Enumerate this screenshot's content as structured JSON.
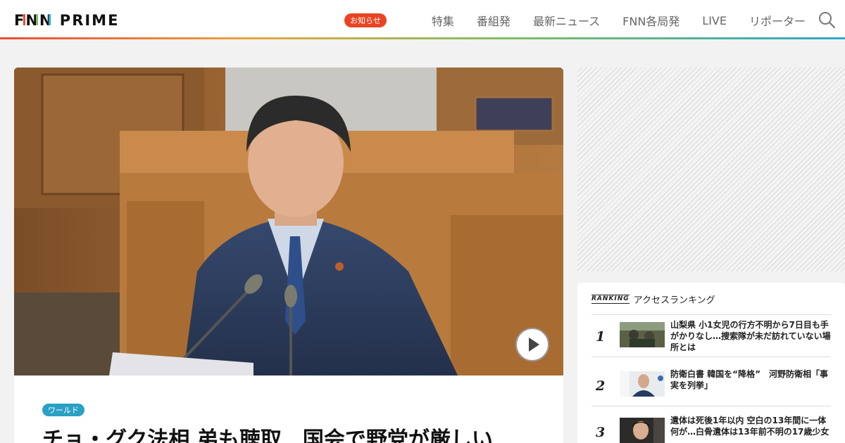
{
  "header": {
    "logo": "FNN PRIME",
    "nav": {
      "badge": "お知らせ",
      "items": [
        "特集",
        "番組発",
        "最新ニュース",
        "FNN各局発",
        "LIVE",
        "リポーター"
      ]
    }
  },
  "article": {
    "category": "ワールド",
    "headline": "チョ・グク法相 弟も聴取　国会で野党が厳しい"
  },
  "ranking": {
    "tag": "RANKING",
    "title": "アクセスランキング",
    "items": [
      {
        "rank": "1",
        "text": "山梨県 小1女児の行方不明から7日目も手がかりなし…捜索隊が未だ訪れていない場所とは"
      },
      {
        "rank": "2",
        "text": "防衛白書 韓国を“降格”　河野防衛相「事実を列挙」"
      },
      {
        "rank": "3",
        "text": "遺体は死後1年以内 空白の13年間に一体何が…白骨遺体は13年前不明の17歳少女"
      }
    ]
  },
  "colors": {
    "accent_red": "#e84423",
    "category_blue": "#2aa0c4"
  }
}
